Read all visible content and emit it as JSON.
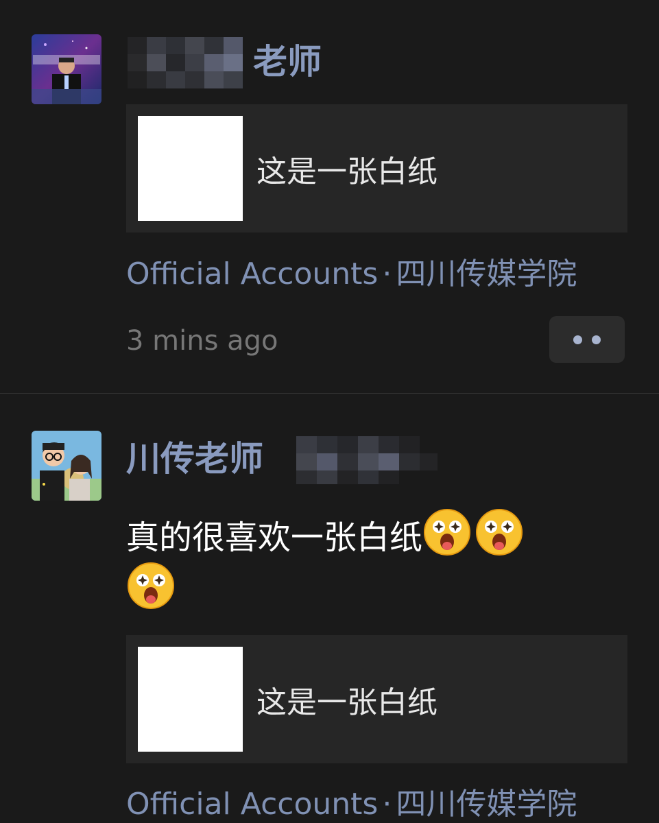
{
  "posts": [
    {
      "author_suffix": "老师",
      "card": {
        "title": "这是一张白纸"
      },
      "source": {
        "label": "Official Accounts",
        "separator": "·",
        "name": "四川传媒学院"
      },
      "time": "3 mins ago"
    },
    {
      "author_prefix": "川传老师",
      "caption": "真的很喜欢一张白纸",
      "caption_emoji": [
        "star-struck-emoji",
        "star-struck-emoji",
        "star-struck-emoji"
      ],
      "card": {
        "title": "这是一张白纸"
      },
      "source": {
        "label": "Official Accounts",
        "separator": "·",
        "name": "四川传媒学院"
      }
    }
  ],
  "colors": {
    "background": "#1a1a1a",
    "author": "#8a9bbf",
    "card": "#262626",
    "source_link": "#8091b4",
    "timestamp": "#777777"
  },
  "icons": [
    "more-dots-icon"
  ]
}
